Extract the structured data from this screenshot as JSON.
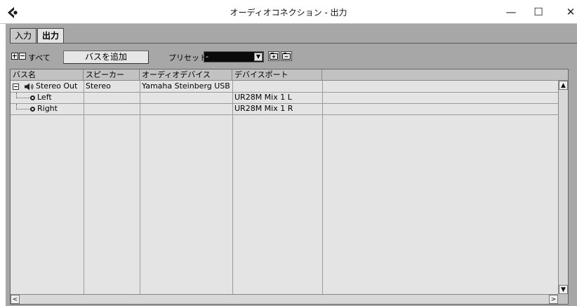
{
  "window": {
    "title": "オーディオコネクション - 出力",
    "minimize_glyph": "—",
    "maximize_glyph": "☐",
    "close_glyph": "✕"
  },
  "tabs": [
    {
      "label": "入力",
      "active": false
    },
    {
      "label": "出力",
      "active": true
    }
  ],
  "toolbar": {
    "all_label": "すべて",
    "add_bus_label": "バスを追加",
    "preset_label": "プリセット",
    "preset_value": "-",
    "expand_icon": "expand-all-icon",
    "collapse_icon": "collapse-all-icon"
  },
  "table": {
    "headers": [
      "バス名",
      "スピーカー",
      "オーディオデバイス",
      "デバイスポート",
      ""
    ],
    "bus": {
      "name": "Stereo Out",
      "speaker": "Stereo",
      "device": "Yamaha Steinberg USB AS",
      "port": ""
    },
    "channels": [
      {
        "name": "Left",
        "speaker": "",
        "device": "",
        "port": "UR28M Mix 1 L"
      },
      {
        "name": "Right",
        "speaker": "",
        "device": "",
        "port": "UR28M Mix 1 R"
      }
    ]
  },
  "scroll": {
    "up": "▲",
    "down": "▼",
    "left": "<",
    "right": ">"
  },
  "colors": {
    "panel_bg": "#a7a7a7",
    "table_bg": "#e4e4e4",
    "header_bg": "#c2c2c2",
    "preset_bg": "#0a0a0a"
  }
}
